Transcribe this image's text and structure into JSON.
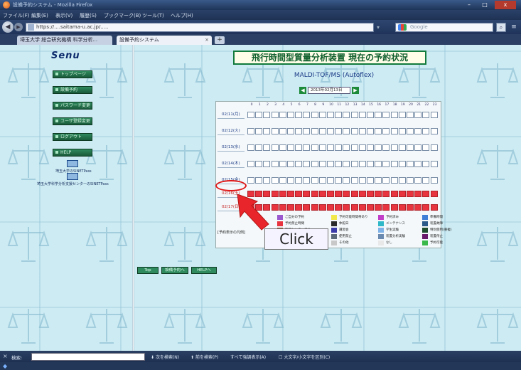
{
  "window": {
    "title": "設備予約システム - Mozilla Firefox",
    "minimize": "–",
    "maximize": "□",
    "close": "x"
  },
  "menu": [
    "ファイル(F)",
    "編集(E)",
    "表示(V)",
    "履歴(S)",
    "ブックマーク(B)",
    "ツール(T)",
    "ヘルプ(H)"
  ],
  "nav": {
    "url": "https://....saitama-u.ac.jp/.....",
    "search_placeholder": "Google",
    "back": "◀",
    "forward": "▶",
    "menu": "≡"
  },
  "tabs": [
    {
      "label": "埼玉大学 総合研究機構 科学分析..."
    },
    {
      "label": "設備予約システム"
    }
  ],
  "new_tab": "+",
  "tab_close": "×",
  "sidebar": {
    "logo": "Senu",
    "buttons": [
      "トップページ",
      "設備予約",
      "パスワード変更",
      "ユーザ登録変更",
      "ログアウト",
      "HELP"
    ],
    "network_links": [
      "埼玉大学のSINETPass",
      "埼玉大学科学分析支援センターのSINETPass"
    ]
  },
  "main": {
    "heading": "飛行時間型質量分析装置 現在の予約状況",
    "instrument": "MALDI-TOF/MS (Autoflex)",
    "month": {
      "prev": "◀",
      "next": "▶",
      "selected": "2013年02月13日"
    },
    "hours": [
      "0",
      "1",
      "2",
      "3",
      "4",
      "5",
      "6",
      "7",
      "8",
      "9",
      "10",
      "11",
      "12",
      "13",
      "14",
      "15",
      "16",
      "17",
      "18",
      "19",
      "20",
      "21",
      "22",
      "23"
    ],
    "days": [
      {
        "label": "02/11(月)",
        "past": false,
        "booked": false
      },
      {
        "label": "02/12(火)",
        "past": false,
        "booked": false
      },
      {
        "label": "02/13(水)",
        "past": false,
        "booked": false
      },
      {
        "label": "02/14(木)",
        "past": false,
        "booked": false
      },
      {
        "label": "02/15(金)",
        "past": false,
        "booked": false
      },
      {
        "label": "02/16(土)",
        "past": true,
        "booked": true
      },
      {
        "label": "02/17(日)",
        "past": true,
        "booked": true
      }
    ],
    "legend_title": "[予約表示の凡例]",
    "legend": [
      {
        "label": "ご自分の予約",
        "color": "#9b59d0"
      },
      {
        "label": "予約可能時間帯あり",
        "color": "#f2e84a"
      },
      {
        "label": "予約済み",
        "color": "#c13fc8"
      },
      {
        "label": "準備時間",
        "color": "#3f7fd8"
      },
      {
        "label": "予約禁止時間",
        "color": "#e8343f"
      },
      {
        "label": "休館日",
        "color": "#2a2a2a"
      },
      {
        "label": "メンテナンス",
        "color": "#2fb9c8"
      },
      {
        "label": "装置故障",
        "color": "#2b5a8a"
      },
      {
        "label": "管理センター予約",
        "color": "#8a4a1a"
      },
      {
        "label": "講習会",
        "color": "#3a3aa8"
      },
      {
        "label": "学生実験",
        "color": "#7fb3e8"
      },
      {
        "label": "特別使用(重複)",
        "color": "#1f4f2f"
      },
      {
        "label": "検収使用(重複)",
        "color": "#b07ad8"
      },
      {
        "label": "使用禁止",
        "color": "#5a6a7a"
      },
      {
        "label": "装置分析実験",
        "color": "#6a8ab0"
      },
      {
        "label": "装置停止",
        "color": "#6a1a6a"
      },
      {
        "label": "予備実習",
        "color": "#f28a1a"
      },
      {
        "label": "その他",
        "color": "#c8c8c8"
      },
      {
        "label": "なし",
        "color": "#e8e8e8"
      },
      {
        "label": "予約可能",
        "color": "#3ab84a"
      }
    ],
    "bottom_buttons": [
      "Top",
      "設備予約へ",
      "HELPへ"
    ]
  },
  "annotation": {
    "click_label": "Click"
  },
  "findbar": {
    "close": "×",
    "label": "検索:",
    "next": "次を検索(N)",
    "prev": "前を検索(P)",
    "highlight": "すべて強調表示(A)",
    "match_case": "大文字/小文字を区別(C)"
  },
  "colors": {
    "accent": "#117a3c",
    "booked": "#e8343f",
    "highlight": "#e01818"
  }
}
